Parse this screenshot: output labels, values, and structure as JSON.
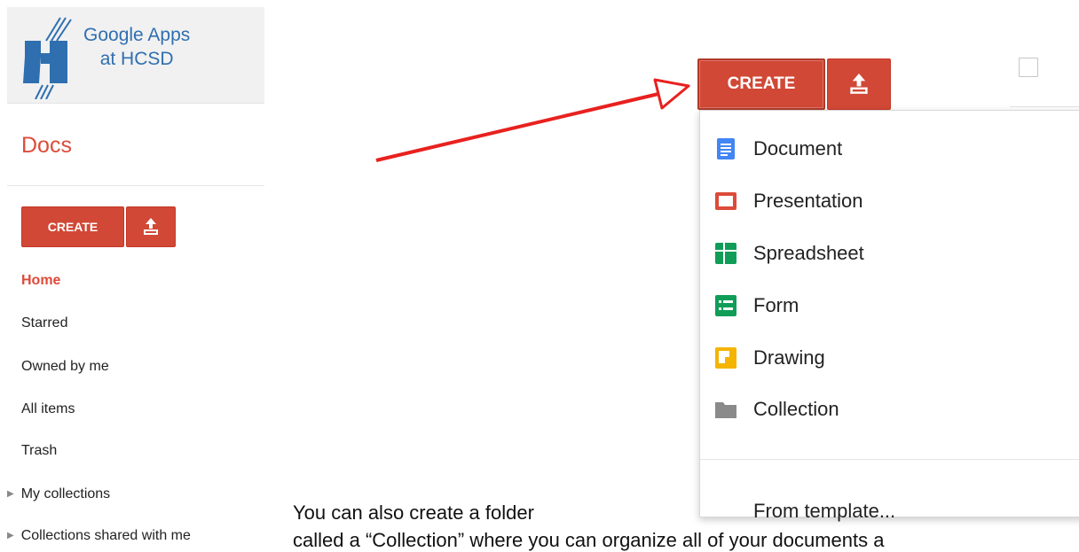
{
  "logo": {
    "line1": "Google Apps",
    "line2": "at HCSD"
  },
  "app_title": "Docs",
  "small_toolbar": {
    "create_label": "CREATE",
    "upload_icon": "upload-icon"
  },
  "nav": {
    "items": [
      "Home",
      "Starred",
      "Owned by me",
      "All items",
      "Trash"
    ],
    "tree": [
      "My collections",
      "Collections shared with me"
    ]
  },
  "big_toolbar": {
    "create_label": "CREATE",
    "upload_icon": "upload-icon"
  },
  "create_menu": {
    "items": [
      "Document",
      "Presentation",
      "Spreadsheet",
      "Form",
      "Drawing",
      "Collection"
    ],
    "from_template": "From template..."
  },
  "caption": {
    "line1": "You can also create a folder",
    "line2": "called a “Collection” where you can organize all of your documents a"
  },
  "colors": {
    "accent_red": "#dd4b39",
    "button_red": "#d14836",
    "doc_blue": "#4285f4",
    "pres_red": "#dd4b39",
    "sheet_green": "#0f9d58",
    "form_green": "#0f9d58",
    "draw_yellow": "#f4b400",
    "collection_gray": "#8a8a8a"
  }
}
